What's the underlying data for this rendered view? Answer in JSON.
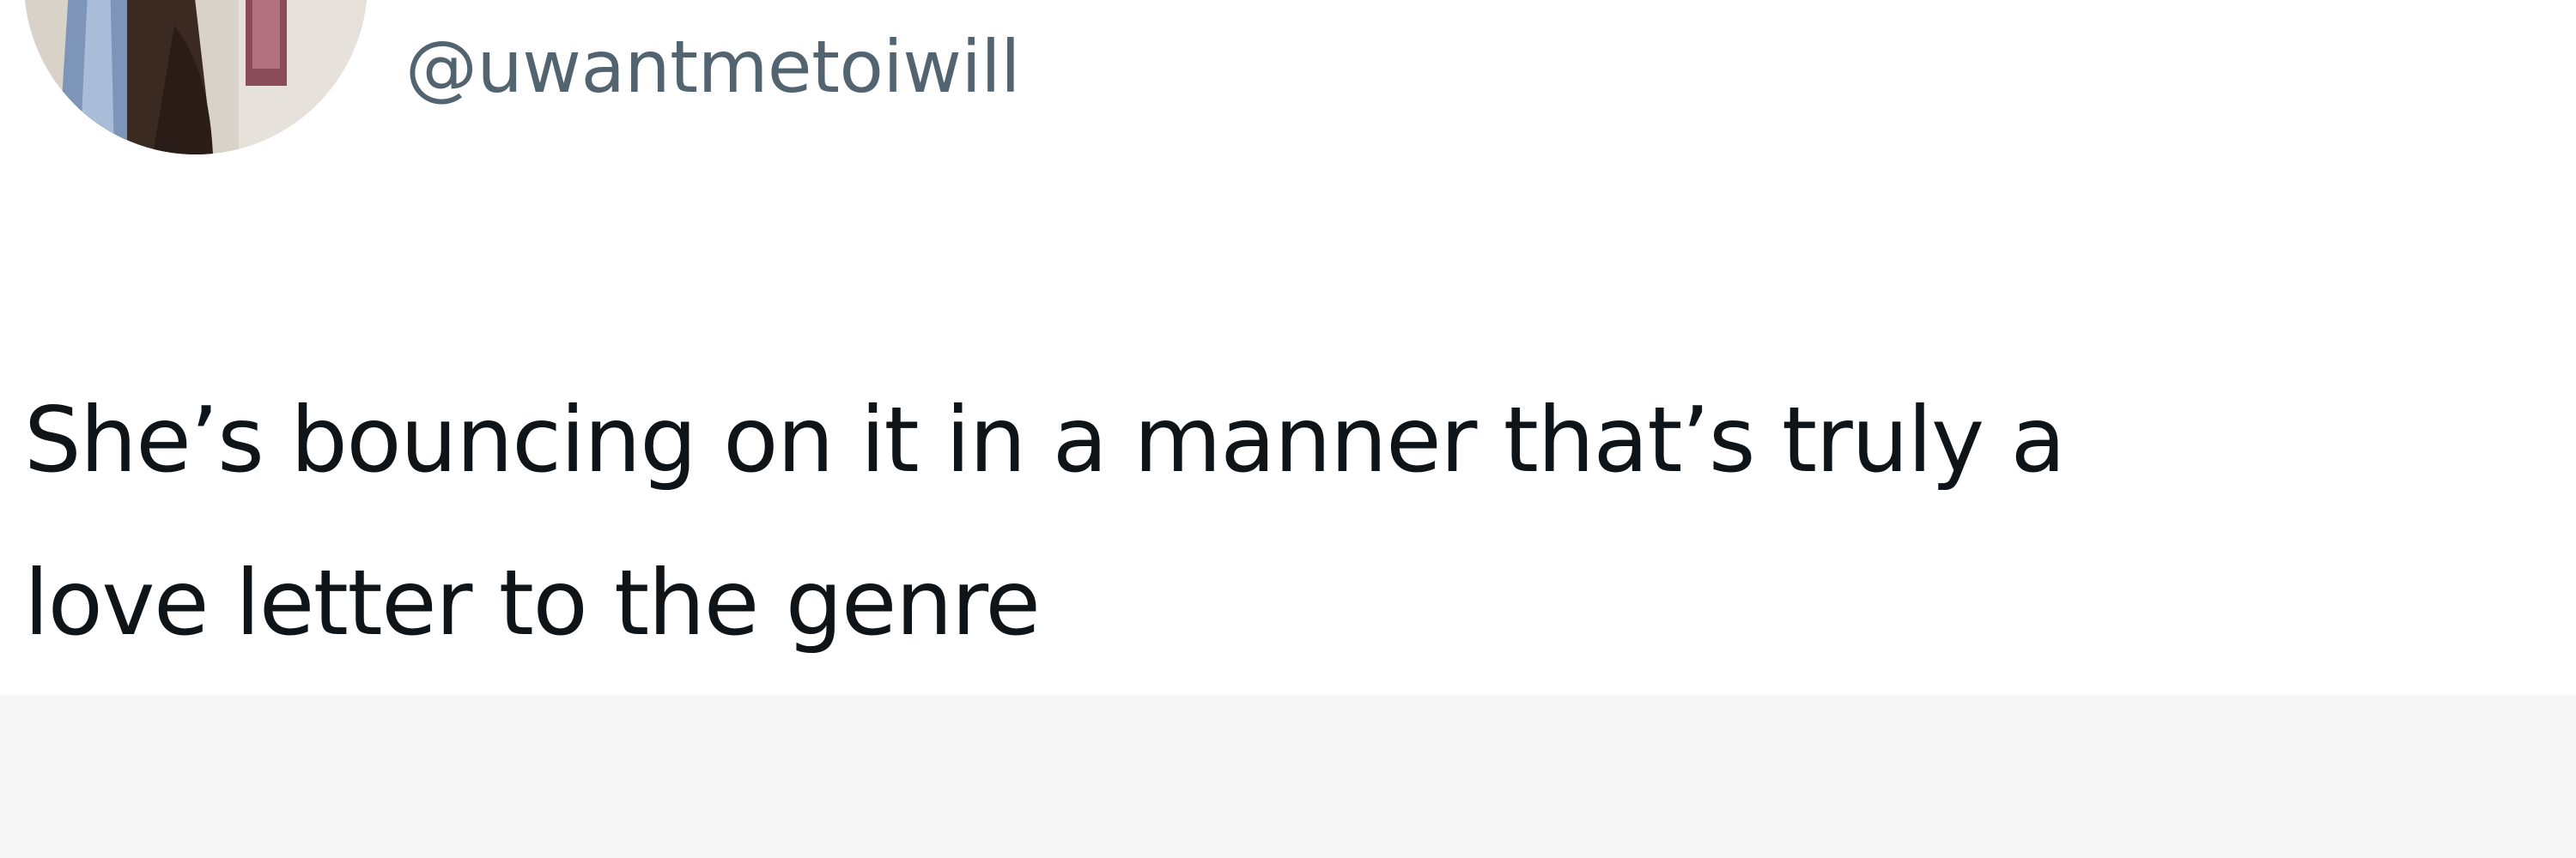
{
  "tweet": {
    "handle": "@uwantmetoiwill",
    "text_lines": [
      "She’s bouncing on it in a manner that’s truly a",
      "love letter to the genre"
    ]
  },
  "colors": {
    "background": "#ffffff",
    "lower_background": "#f7f7f7",
    "handle": "#536471",
    "text": "#0f1419"
  }
}
